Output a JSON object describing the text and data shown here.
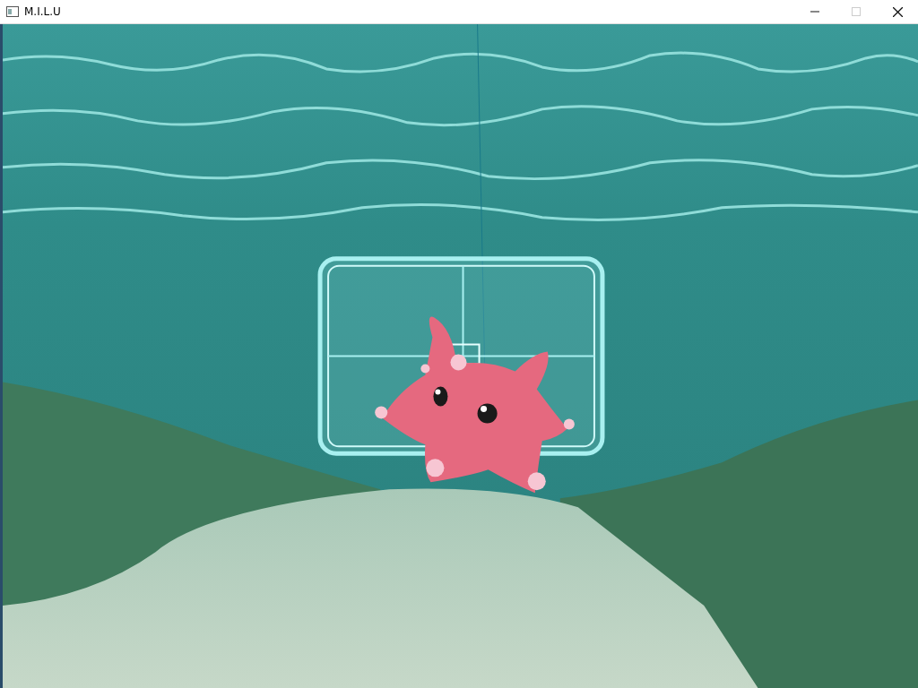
{
  "window": {
    "title": "M.I.L.U",
    "buttons": [
      {
        "kind": "minimize",
        "disabled": false
      },
      {
        "kind": "maximize",
        "disabled": true
      },
      {
        "kind": "close",
        "disabled": false
      }
    ]
  }
}
